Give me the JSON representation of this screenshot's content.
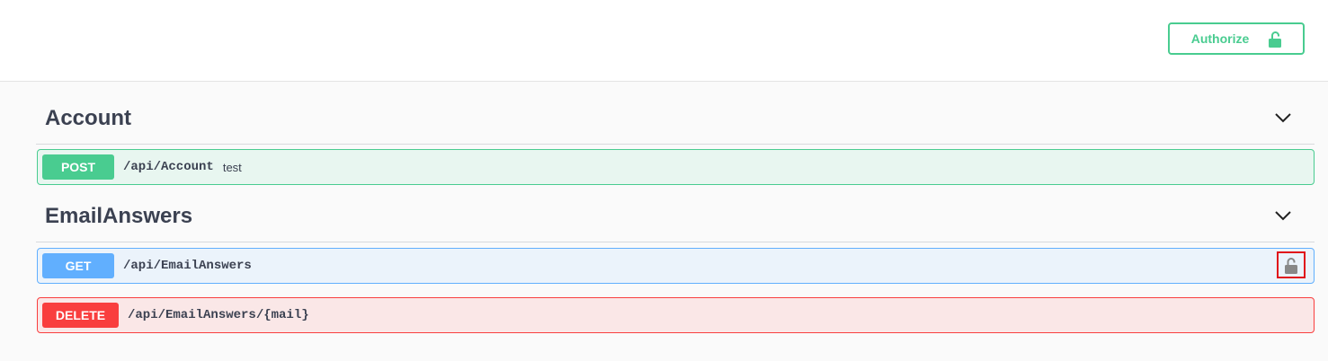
{
  "header": {
    "authorize_label": "Authorize",
    "authorize_icon": "unlock-icon",
    "accent_color": "#49cc90"
  },
  "tags": [
    {
      "name": "Account",
      "operations": [
        {
          "method": "POST",
          "path": "/api/Account",
          "summary": "test",
          "color": "#49cc90"
        }
      ]
    },
    {
      "name": "EmailAnswers",
      "operations": [
        {
          "method": "GET",
          "path": "/api/EmailAnswers",
          "summary": "",
          "color": "#61affe",
          "lock_icon": "unlock-icon"
        },
        {
          "method": "DELETE",
          "path": "/api/EmailAnswers/{mail}",
          "summary": "",
          "color": "#f93e3e"
        }
      ]
    }
  ]
}
